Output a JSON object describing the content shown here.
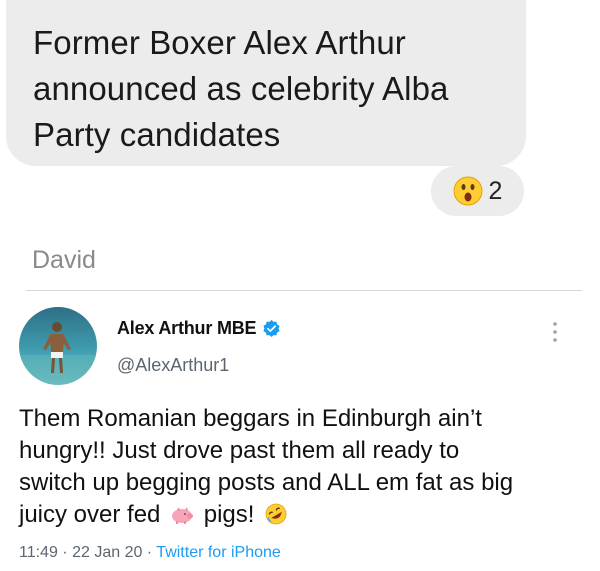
{
  "message": {
    "text_lines": [
      "Former Boxer Alex Arthur",
      "announced as celebrity Alba",
      "Party candidates"
    ],
    "reaction": {
      "emoji_name": "astonished-face",
      "count": "2"
    }
  },
  "sender": {
    "name": "David"
  },
  "tweet": {
    "display_name": "Alex Arthur MBE",
    "handle": "@AlexArthur1",
    "verified": true,
    "text": {
      "line1": "Them Romanian beggars in Edinburgh ain’t",
      "line2": "hungry!! Just drove past them all ready to",
      "line3": "switch up begging posts and ALL em fat as big",
      "line4_a": "juicy over fed",
      "line4_b": "pigs!",
      "emoji_1": "pig-icon",
      "emoji_2": "rolling-on-floor-laughing-icon"
    },
    "time": "11:49",
    "date": "22 Jan 20",
    "source": "Twitter for iPhone",
    "separator": " · "
  },
  "colors": {
    "bubble": "#ececec",
    "link": "#1d9bf0",
    "verified": "#1d9bf0",
    "muted": "#5b6670"
  }
}
